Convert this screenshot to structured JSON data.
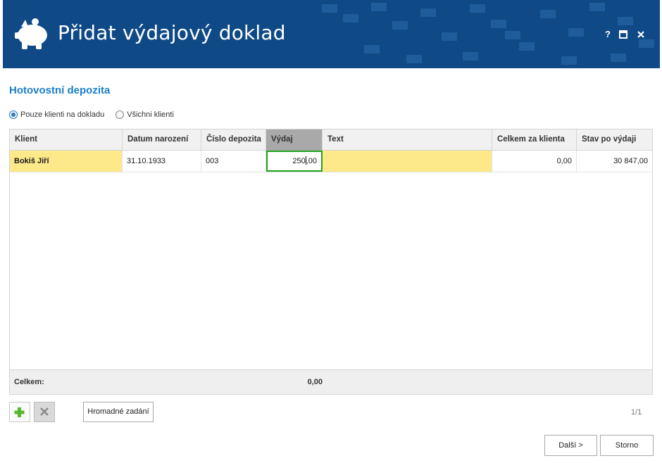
{
  "window": {
    "title": "Přidat výdajový doklad",
    "help_label": "?"
  },
  "section": {
    "title": "Hotovostní depozita"
  },
  "filter": {
    "options": [
      {
        "label": "Pouze klienti na dokladu",
        "selected": true
      },
      {
        "label": "Všichni klienti",
        "selected": false
      }
    ]
  },
  "table": {
    "columns": [
      "Klient",
      "Datum narození",
      "Číslo depozita",
      "Výdaj",
      "Text",
      "Celkem za klienta",
      "Stav po výdaji"
    ],
    "active_column": "Výdaj",
    "rows": [
      {
        "klient": "Bokiš Jiří",
        "datum": "31.10.1933",
        "cislo": "003",
        "vydaj_before_cursor": "250",
        "vydaj_after_cursor": ",00",
        "text": "",
        "celkem": "0,00",
        "stav": "30 847,00"
      }
    ],
    "footer": {
      "label": "Celkem:",
      "vydaj_total": "0,00"
    }
  },
  "toolbar": {
    "bulk_label": "Hromadné zadání",
    "page": "1/1"
  },
  "actions": {
    "next_label": "Další >",
    "cancel_label": "Storno"
  },
  "colors": {
    "header_bg": "#0f4a87",
    "accent_title": "#1a7fc8",
    "selected_row": "#fde98a",
    "edit_border": "#1fa31f",
    "add_icon": "#5ab52f"
  }
}
